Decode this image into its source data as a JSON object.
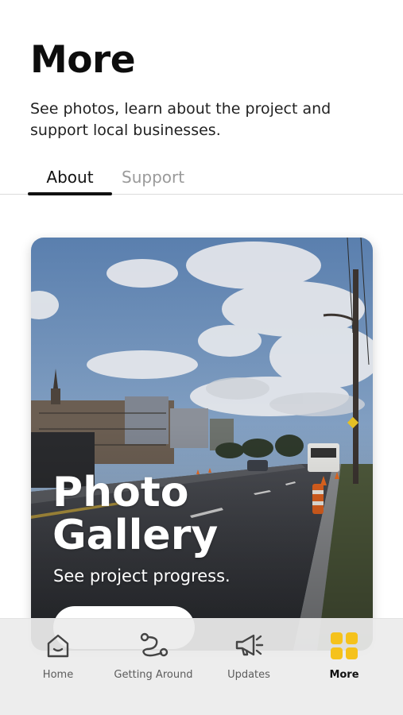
{
  "header": {
    "title": "More",
    "subtitle": "See photos, learn about the project and support local businesses."
  },
  "tabs": [
    {
      "label": "About",
      "active": true
    },
    {
      "label": "Support",
      "active": false
    }
  ],
  "card": {
    "title": "Photo Gallery",
    "subtitle": "See project progress."
  },
  "tabbar": {
    "items": [
      {
        "label": "Home",
        "icon": "home-icon",
        "active": false
      },
      {
        "label": "Getting Around",
        "icon": "route-icon",
        "active": false
      },
      {
        "label": "Updates",
        "icon": "megaphone-icon",
        "active": false
      },
      {
        "label": "More",
        "icon": "grid-icon",
        "active": true
      }
    ],
    "accent": "#F5C21B"
  },
  "colors": {
    "text": "#111111",
    "muted": "#9A9A9A",
    "accent": "#F5C21B"
  }
}
